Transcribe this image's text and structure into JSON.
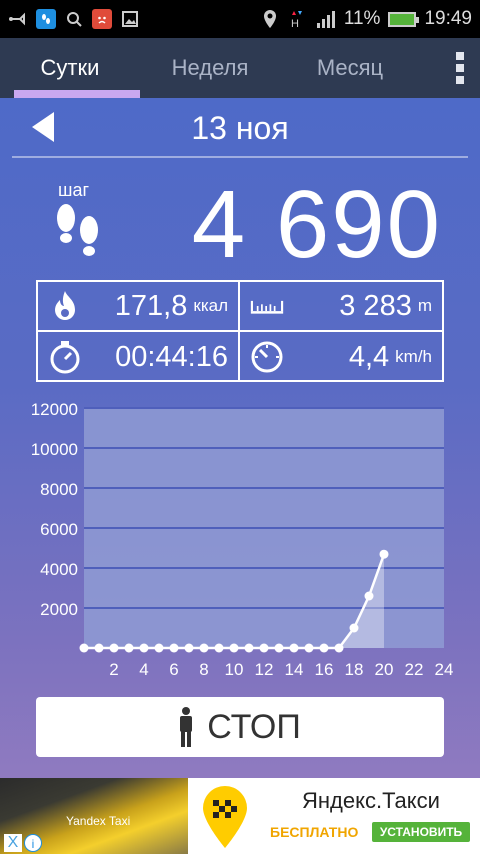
{
  "status_bar": {
    "battery": "11%",
    "time": "19:49",
    "notifications": [
      "usb-debug-icon",
      "pedometer-app-icon",
      "search-icon",
      "angry-app-icon",
      "gallery-icon"
    ],
    "status_icons": [
      "location-icon",
      "data-h-icon",
      "signal-icon",
      "battery-icon"
    ]
  },
  "tabs": [
    {
      "label": "Сутки",
      "active": true
    },
    {
      "label": "Неделя",
      "active": false
    },
    {
      "label": "Месяц",
      "active": false
    }
  ],
  "date": {
    "label": "13 ноя"
  },
  "steps": {
    "label": "шаг",
    "value": "4 690"
  },
  "stats": {
    "calories": {
      "value": "171,8",
      "unit": "ккал"
    },
    "distance": {
      "value": "3 283",
      "unit": "m"
    },
    "duration": {
      "value": "00:44:16",
      "unit": ""
    },
    "speed": {
      "value": "4,4",
      "unit": "km/h"
    }
  },
  "chart_data": {
    "type": "line",
    "title": "",
    "xlabel": "",
    "ylabel": "",
    "ylim": [
      0,
      12000
    ],
    "xlim": [
      0,
      24
    ],
    "y_ticks": [
      2000,
      4000,
      6000,
      8000,
      10000,
      12000
    ],
    "x_ticks": [
      2,
      4,
      6,
      8,
      10,
      12,
      14,
      16,
      18,
      20,
      22,
      24
    ],
    "x": [
      0,
      1,
      2,
      3,
      4,
      5,
      6,
      7,
      8,
      9,
      10,
      11,
      12,
      13,
      14,
      15,
      16,
      17,
      18,
      19,
      20
    ],
    "values": [
      0,
      0,
      0,
      0,
      0,
      0,
      0,
      0,
      0,
      0,
      0,
      0,
      0,
      0,
      0,
      0,
      0,
      0,
      1000,
      2600,
      4690
    ],
    "grid": true,
    "colors": {
      "line": "#ffffff",
      "plot_bg": "#8f9bd3",
      "grid": "#4f5fbb"
    }
  },
  "stop_button": {
    "label": "СТОП"
  },
  "ad": {
    "photo_caption": "Yandex Taxi",
    "brand": "Яндекс.Такси",
    "free_label": "БЕСПЛАТНО",
    "install_label": "УСТАНОВИТЬ",
    "close_symbol": "X",
    "info_symbol": "i"
  },
  "colors": {
    "tabbar": "#2e3a52",
    "tab_indicator": "#c9a8f0",
    "ad_install": "#55b33a",
    "ad_free": "#f0a500"
  }
}
